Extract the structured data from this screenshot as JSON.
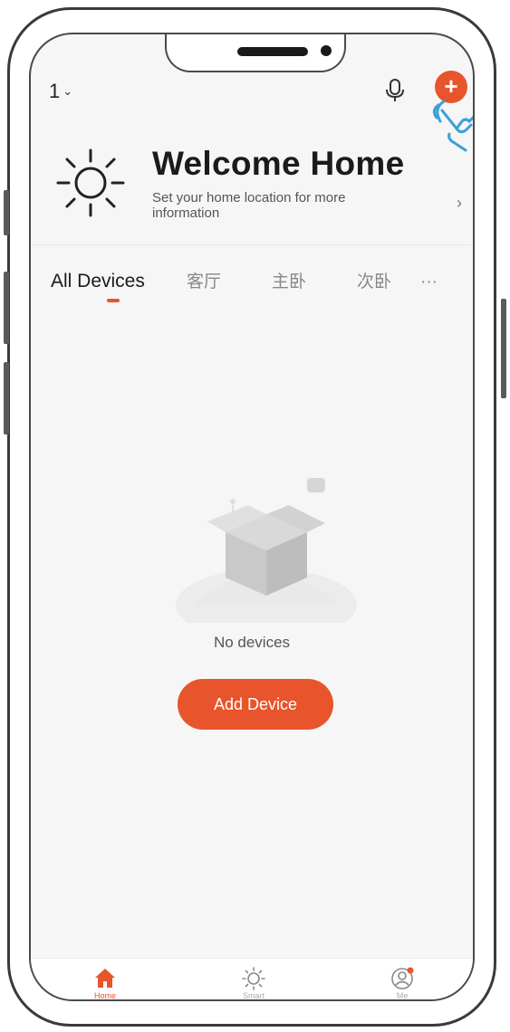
{
  "header": {
    "home_number": "1",
    "chevron": "⌄"
  },
  "welcome": {
    "title": "Welcome Home",
    "subtitle": "Set your home location for more information",
    "arrow": "›"
  },
  "tabs": [
    {
      "label": "All Devices",
      "active": true
    },
    {
      "label": "客厅",
      "active": false
    },
    {
      "label": "主卧",
      "active": false
    },
    {
      "label": "次卧",
      "active": false
    },
    {
      "label": "···",
      "active": false
    }
  ],
  "empty_state": {
    "message": "No devices",
    "button_label": "Add Device"
  },
  "bottom_nav": [
    {
      "label": "Home",
      "icon": "home-icon",
      "active": true
    },
    {
      "label": "Smart",
      "icon": "sun-icon",
      "active": false
    },
    {
      "label": "Me",
      "icon": "profile-icon",
      "active": false
    }
  ],
  "colors": {
    "accent": "#e8542b",
    "hand_overlay": "#3aa0d8",
    "background": "#f6f6f6"
  }
}
